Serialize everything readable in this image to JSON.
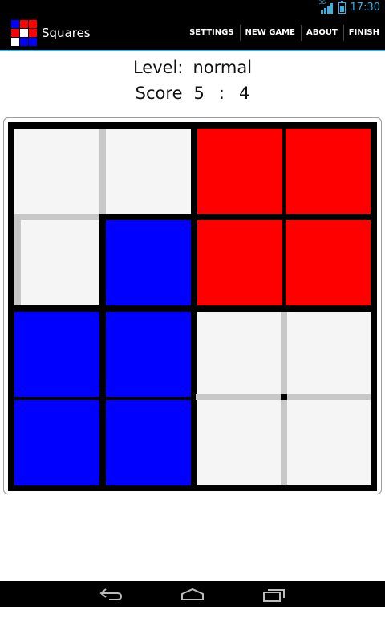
{
  "status_bar": {
    "time": "17:30",
    "network": "3G",
    "icons": [
      "signal-icon",
      "battery-icon"
    ]
  },
  "action_bar": {
    "title": "Squares",
    "logo_icon": "squares-logo-icon",
    "menu": [
      "SETTINGS",
      "NEW GAME",
      "ABOUT",
      "FINISH"
    ]
  },
  "info": {
    "level_label": "Level:",
    "level_value": "normal",
    "score_label": "Score",
    "score_a": "5",
    "score_separator": ":",
    "score_b": "4"
  },
  "colors": {
    "red": "#ff0000",
    "blue": "#0000ff",
    "white": "#f5f5f5",
    "border": "#000000",
    "grid": "#c8c8c8",
    "accent": "#33b5e5"
  },
  "board": {
    "rows": [
      [
        "white",
        "white",
        "red",
        "red"
      ],
      [
        "white",
        "blue",
        "red",
        "red"
      ],
      [
        "blue",
        "blue",
        "white",
        "white"
      ],
      [
        "blue",
        "blue",
        "white",
        "white"
      ]
    ]
  },
  "nav_bar": [
    "back-icon",
    "home-icon",
    "recent-apps-icon"
  ]
}
